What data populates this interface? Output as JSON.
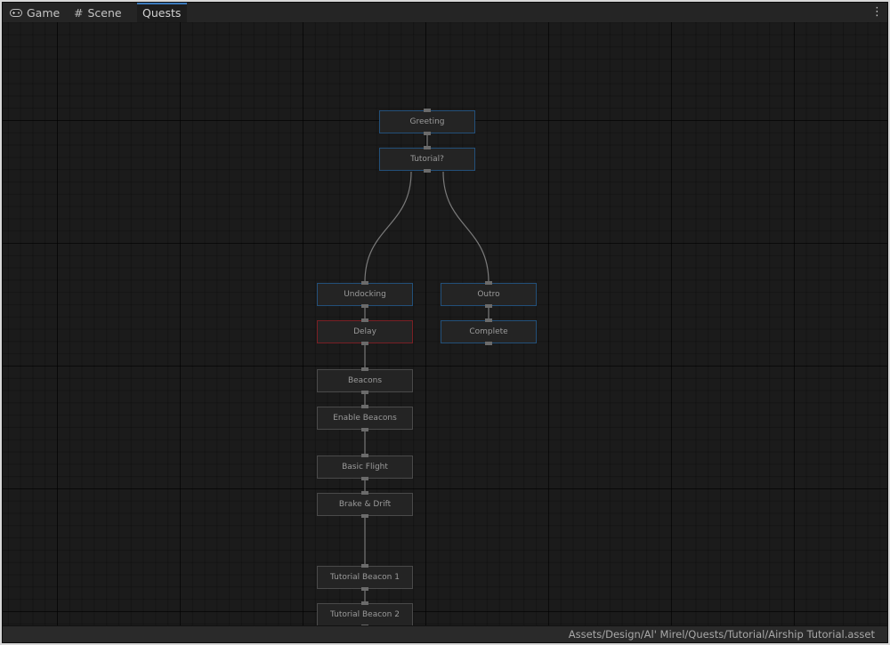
{
  "tabs": [
    {
      "label": "Game",
      "icon": "gamepad-icon"
    },
    {
      "label": "Scene",
      "icon": "grid-icon"
    },
    {
      "label": "Quests",
      "active": true
    }
  ],
  "menu": {
    "icon": "kebab-menu-icon",
    "glyph": "⋮"
  },
  "graph": {
    "nodes": [
      {
        "id": "greeting",
        "label": "Greeting",
        "style": "blue"
      },
      {
        "id": "tutorial",
        "label": "Tutorial?",
        "style": "blue"
      },
      {
        "id": "undocking",
        "label": "Undocking",
        "style": "blue"
      },
      {
        "id": "outro",
        "label": "Outro",
        "style": "blue"
      },
      {
        "id": "delay",
        "label": "Delay",
        "style": "red"
      },
      {
        "id": "complete",
        "label": "Complete",
        "style": "blue"
      },
      {
        "id": "beacons",
        "label": "Beacons",
        "style": "default"
      },
      {
        "id": "enable_beacons",
        "label": "Enable Beacons",
        "style": "default"
      },
      {
        "id": "basic_flight",
        "label": "Basic Flight",
        "style": "default"
      },
      {
        "id": "brake_drift",
        "label": "Brake & Drift",
        "style": "default"
      },
      {
        "id": "tutorial_beacon_1",
        "label": "Tutorial Beacon 1",
        "style": "default"
      },
      {
        "id": "tutorial_beacon_2",
        "label": "Tutorial Beacon 2",
        "style": "default"
      }
    ],
    "edges": [
      [
        "greeting",
        "tutorial"
      ],
      [
        "tutorial",
        "undocking"
      ],
      [
        "tutorial",
        "outro"
      ],
      [
        "undocking",
        "delay"
      ],
      [
        "outro",
        "complete"
      ],
      [
        "delay",
        "beacons"
      ],
      [
        "beacons",
        "enable_beacons"
      ],
      [
        "enable_beacons",
        "basic_flight"
      ],
      [
        "basic_flight",
        "brake_drift"
      ],
      [
        "brake_drift",
        "tutorial_beacon_1"
      ],
      [
        "tutorial_beacon_1",
        "tutorial_beacon_2"
      ]
    ],
    "colors": {
      "blue": "#23507a",
      "red": "#7a1f24",
      "default": "#4a4a4a",
      "edge": "#7a7a7a"
    }
  },
  "status": {
    "asset_path": "Assets/Design/Al' Mirel/Quests/Tutorial/Airship Tutorial.asset"
  }
}
